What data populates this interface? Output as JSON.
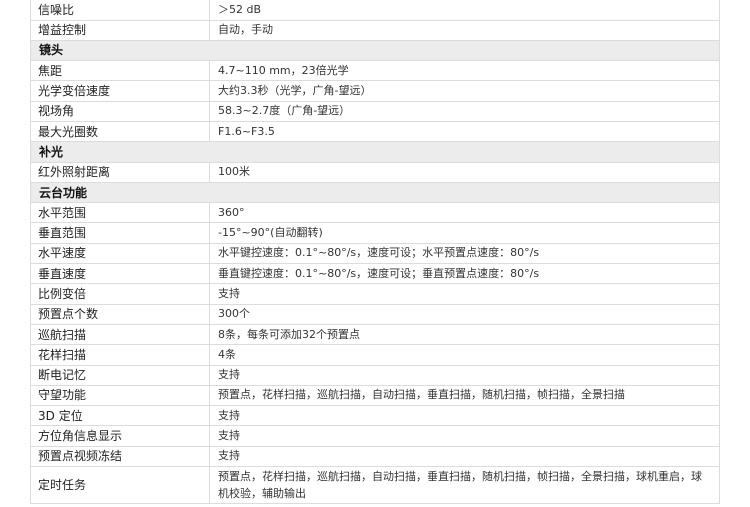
{
  "rows": [
    {
      "type": "row",
      "key": "信噪比",
      "value": "＞52 dB"
    },
    {
      "type": "row",
      "key": "增益控制",
      "value": "自动，手动"
    },
    {
      "type": "section",
      "key": "镜头"
    },
    {
      "type": "row",
      "key": "焦距",
      "value": "4.7~110 mm，23倍光学"
    },
    {
      "type": "row",
      "key": "光学变倍速度",
      "value": "大约3.3秒（光学，广角-望远）"
    },
    {
      "type": "row",
      "key": "视场角",
      "value": "58.3~2.7度（广角-望远）"
    },
    {
      "type": "row",
      "key": "最大光圈数",
      "value": "F1.6~F3.5"
    },
    {
      "type": "section",
      "key": "补光"
    },
    {
      "type": "row",
      "key": "红外照射距离",
      "value": "100米"
    },
    {
      "type": "section",
      "key": "云台功能"
    },
    {
      "type": "row",
      "key": "水平范围",
      "value": "360°"
    },
    {
      "type": "row",
      "key": "垂直范围",
      "value": "-15°~90°(自动翻转)"
    },
    {
      "type": "row",
      "key": "水平速度",
      "value": "水平键控速度：0.1°~80°/s，速度可设；水平预置点速度：80°/s"
    },
    {
      "type": "row",
      "key": "垂直速度",
      "value": "垂直键控速度：0.1°~80°/s，速度可设；垂直预置点速度：80°/s"
    },
    {
      "type": "row",
      "key": "比例变倍",
      "value": "支持"
    },
    {
      "type": "row",
      "key": "预置点个数",
      "value": "300个"
    },
    {
      "type": "row",
      "key": "巡航扫描",
      "value": "8条，每条可添加32个预置点"
    },
    {
      "type": "row",
      "key": "花样扫描",
      "value": "4条"
    },
    {
      "type": "row",
      "key": "断电记忆",
      "value": "支持"
    },
    {
      "type": "row",
      "key": "守望功能",
      "value": "预置点，花样扫描，巡航扫描，自动扫描，垂直扫描，随机扫描，帧扫描，全景扫描"
    },
    {
      "type": "row",
      "key": "3D 定位",
      "value": "支持"
    },
    {
      "type": "row",
      "key": "方位角信息显示",
      "value": "支持"
    },
    {
      "type": "row",
      "key": "预置点视频冻结",
      "value": "支持"
    },
    {
      "type": "tall",
      "key": "定时任务",
      "value": "预置点，花样扫描，巡航扫描，自动扫描，垂直扫描，随机扫描，帧扫描，全景扫描，球机重启，球机校验，辅助输出"
    }
  ]
}
